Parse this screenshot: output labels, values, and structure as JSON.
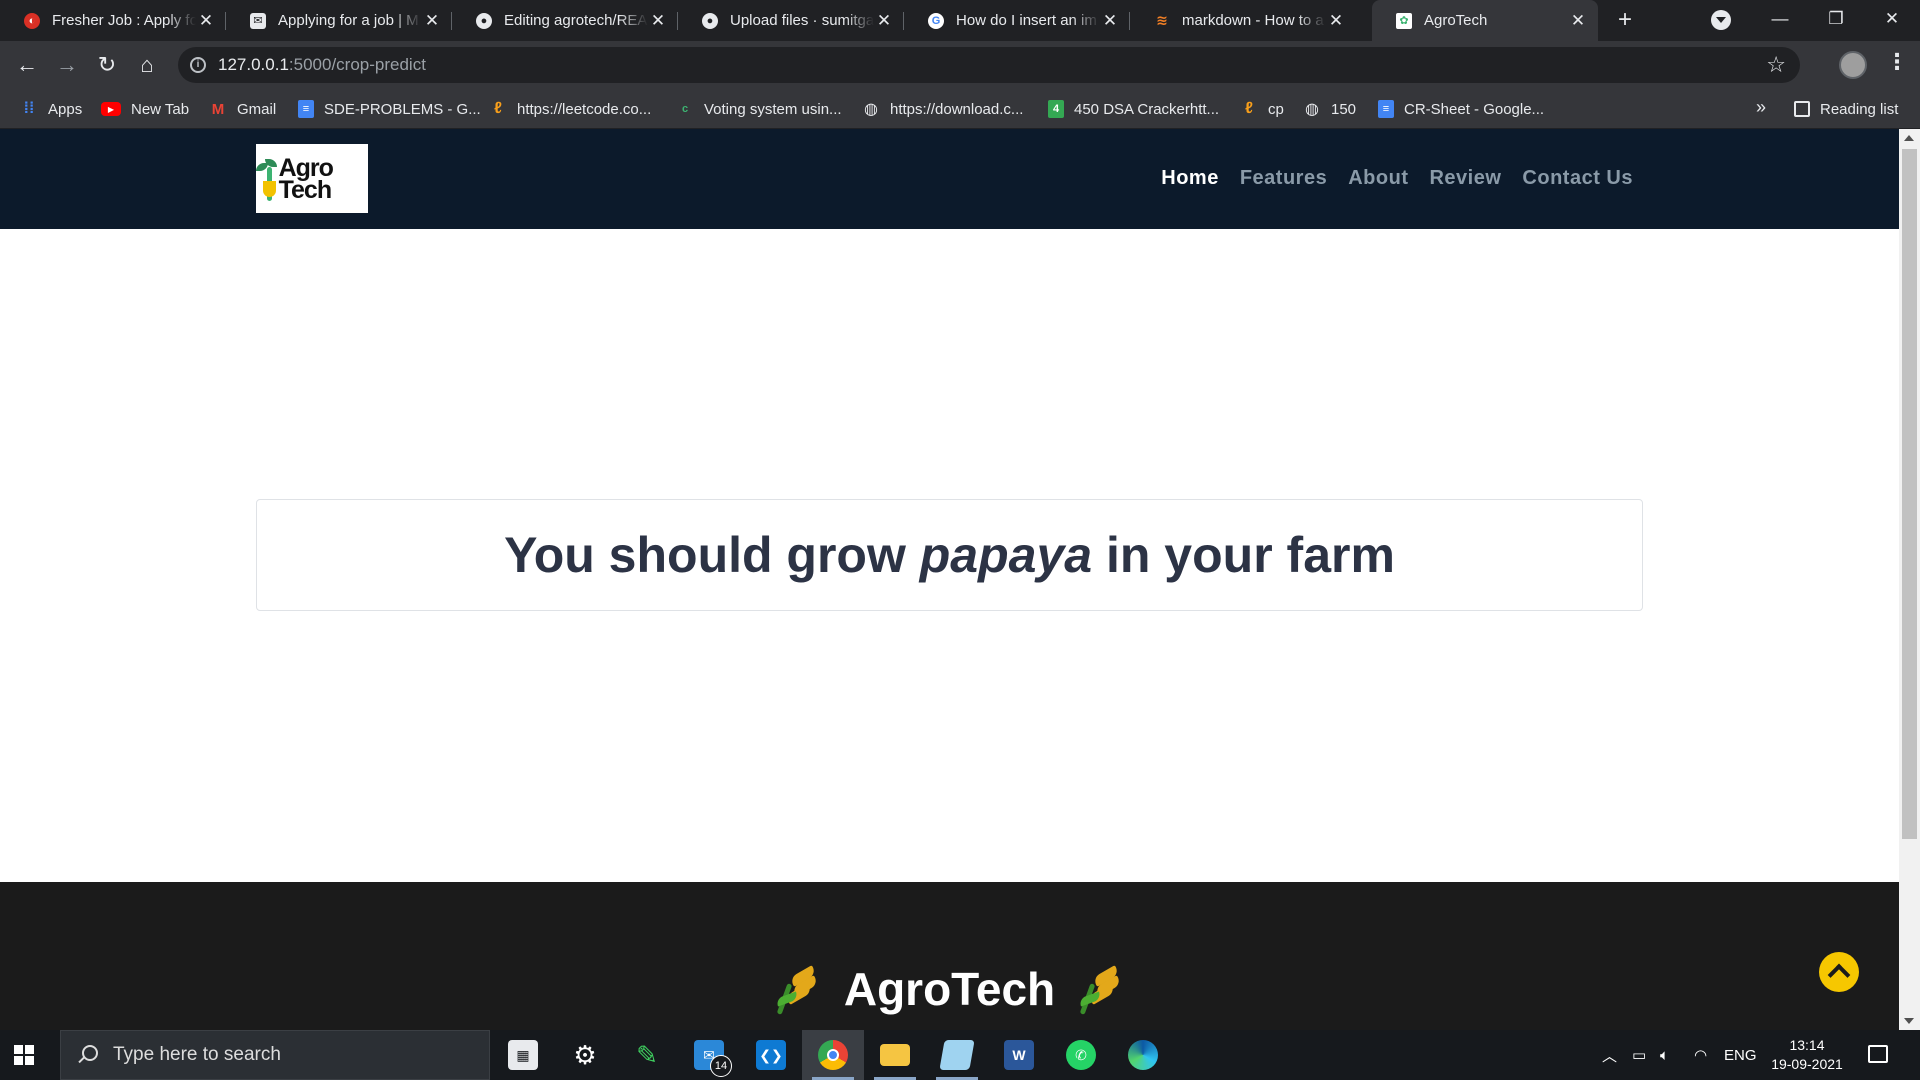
{
  "browser": {
    "tabs": [
      {
        "title": "Fresher Job : Apply for",
        "favicon": "job-site-icon",
        "color": "#d93025"
      },
      {
        "title": "Applying for a job | M",
        "favicon": "mail-icon",
        "color": "#e8eaed"
      },
      {
        "title": "Editing agrotech/REA",
        "favicon": "github-icon",
        "color": "#e8eaed"
      },
      {
        "title": "Upload files · sumitga",
        "favicon": "github-icon",
        "color": "#e8eaed"
      },
      {
        "title": "How do I insert an im",
        "favicon": "google-icon",
        "color": "#ffffff"
      },
      {
        "title": "markdown - How to a",
        "favicon": "stackoverflow-icon",
        "color": "#f48024"
      },
      {
        "title": "AgroTech",
        "favicon": "agrotech-icon",
        "color": "#3cb371"
      }
    ],
    "active_tab_index": 6,
    "url_host": "127.0.0.1",
    "url_path": ":5000/crop-predict",
    "bookmarks": [
      {
        "label": "Apps",
        "icon": "apps-grid-icon"
      },
      {
        "label": "New Tab",
        "icon": "youtube-icon"
      },
      {
        "label": "Gmail",
        "icon": "gmail-icon"
      },
      {
        "label": "SDE-PROBLEMS - G...",
        "icon": "docs-icon"
      },
      {
        "label": "https://leetcode.co...",
        "icon": "leetcode-icon"
      },
      {
        "label": "Voting system usin...",
        "icon": "code-icon"
      },
      {
        "label": "https://download.c...",
        "icon": "globe-icon"
      },
      {
        "label": "450 DSA Crackerhtt...",
        "icon": "sheets-icon"
      },
      {
        "label": "cp",
        "icon": "leetcode-icon"
      },
      {
        "label": "150",
        "icon": "globe-icon"
      },
      {
        "label": "CR-Sheet - Google...",
        "icon": "docs-icon"
      }
    ],
    "reading_list_label": "Reading list"
  },
  "site": {
    "logo_text": "Agro Tech",
    "nav": [
      "Home",
      "Features",
      "About",
      "Review",
      "Contact Us"
    ],
    "active_nav": "Home",
    "result_prefix": "You should grow ",
    "result_crop": "papaya",
    "result_suffix": " in your farm",
    "footer_brand": "AgroTech"
  },
  "taskbar": {
    "search_placeholder": "Type here to search",
    "apps": [
      {
        "name": "store",
        "icon": "store-icon"
      },
      {
        "name": "settings",
        "icon": "gear-icon"
      },
      {
        "name": "pen",
        "icon": "pen-icon"
      },
      {
        "name": "mail",
        "icon": "mail-icon",
        "badge": "14"
      },
      {
        "name": "vscode",
        "icon": "vscode-icon"
      },
      {
        "name": "chrome",
        "icon": "chrome-icon"
      },
      {
        "name": "file-explorer",
        "icon": "folder-icon"
      },
      {
        "name": "notepad",
        "icon": "notepad-icon"
      },
      {
        "name": "word",
        "icon": "word-icon"
      },
      {
        "name": "whatsapp",
        "icon": "whatsapp-icon"
      },
      {
        "name": "edge",
        "icon": "edge-icon"
      }
    ],
    "language": "ENG",
    "time": "13:14",
    "date": "19-09-2021"
  },
  "colors": {
    "navbar_bg": "#0c1a2b",
    "footer_bg": "#1b1b1b",
    "accent": "#f6c700",
    "result_text": "#2c3345"
  }
}
